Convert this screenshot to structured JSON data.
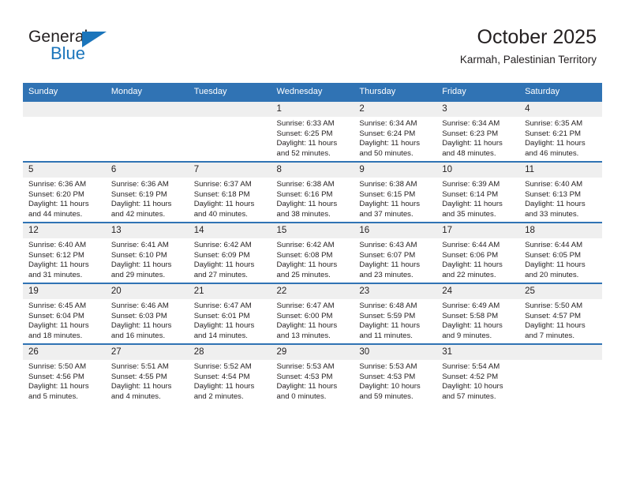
{
  "brand": {
    "name_top": "General",
    "name_bottom": "Blue",
    "accent_color": "#1b75bb",
    "triangle_icon": "triangle-icon"
  },
  "header": {
    "title": "October 2025",
    "subtitle": "Karmah, Palestinian Territory",
    "header_bar_color": "#3073b4"
  },
  "calendar": {
    "weekday_headers": [
      "Sunday",
      "Monday",
      "Tuesday",
      "Wednesday",
      "Thursday",
      "Friday",
      "Saturday"
    ],
    "labels": {
      "sunrise": "Sunrise:",
      "sunset": "Sunset:",
      "daylight": "Daylight:"
    },
    "weeks": [
      [
        {
          "day": ""
        },
        {
          "day": ""
        },
        {
          "day": ""
        },
        {
          "day": "1",
          "sunrise": "Sunrise: 6:33 AM",
          "sunset": "Sunset: 6:25 PM",
          "daylight1": "Daylight: 11 hours",
          "daylight2": "and 52 minutes."
        },
        {
          "day": "2",
          "sunrise": "Sunrise: 6:34 AM",
          "sunset": "Sunset: 6:24 PM",
          "daylight1": "Daylight: 11 hours",
          "daylight2": "and 50 minutes."
        },
        {
          "day": "3",
          "sunrise": "Sunrise: 6:34 AM",
          "sunset": "Sunset: 6:23 PM",
          "daylight1": "Daylight: 11 hours",
          "daylight2": "and 48 minutes."
        },
        {
          "day": "4",
          "sunrise": "Sunrise: 6:35 AM",
          "sunset": "Sunset: 6:21 PM",
          "daylight1": "Daylight: 11 hours",
          "daylight2": "and 46 minutes."
        }
      ],
      [
        {
          "day": "5",
          "sunrise": "Sunrise: 6:36 AM",
          "sunset": "Sunset: 6:20 PM",
          "daylight1": "Daylight: 11 hours",
          "daylight2": "and 44 minutes."
        },
        {
          "day": "6",
          "sunrise": "Sunrise: 6:36 AM",
          "sunset": "Sunset: 6:19 PM",
          "daylight1": "Daylight: 11 hours",
          "daylight2": "and 42 minutes."
        },
        {
          "day": "7",
          "sunrise": "Sunrise: 6:37 AM",
          "sunset": "Sunset: 6:18 PM",
          "daylight1": "Daylight: 11 hours",
          "daylight2": "and 40 minutes."
        },
        {
          "day": "8",
          "sunrise": "Sunrise: 6:38 AM",
          "sunset": "Sunset: 6:16 PM",
          "daylight1": "Daylight: 11 hours",
          "daylight2": "and 38 minutes."
        },
        {
          "day": "9",
          "sunrise": "Sunrise: 6:38 AM",
          "sunset": "Sunset: 6:15 PM",
          "daylight1": "Daylight: 11 hours",
          "daylight2": "and 37 minutes."
        },
        {
          "day": "10",
          "sunrise": "Sunrise: 6:39 AM",
          "sunset": "Sunset: 6:14 PM",
          "daylight1": "Daylight: 11 hours",
          "daylight2": "and 35 minutes."
        },
        {
          "day": "11",
          "sunrise": "Sunrise: 6:40 AM",
          "sunset": "Sunset: 6:13 PM",
          "daylight1": "Daylight: 11 hours",
          "daylight2": "and 33 minutes."
        }
      ],
      [
        {
          "day": "12",
          "sunrise": "Sunrise: 6:40 AM",
          "sunset": "Sunset: 6:12 PM",
          "daylight1": "Daylight: 11 hours",
          "daylight2": "and 31 minutes."
        },
        {
          "day": "13",
          "sunrise": "Sunrise: 6:41 AM",
          "sunset": "Sunset: 6:10 PM",
          "daylight1": "Daylight: 11 hours",
          "daylight2": "and 29 minutes."
        },
        {
          "day": "14",
          "sunrise": "Sunrise: 6:42 AM",
          "sunset": "Sunset: 6:09 PM",
          "daylight1": "Daylight: 11 hours",
          "daylight2": "and 27 minutes."
        },
        {
          "day": "15",
          "sunrise": "Sunrise: 6:42 AM",
          "sunset": "Sunset: 6:08 PM",
          "daylight1": "Daylight: 11 hours",
          "daylight2": "and 25 minutes."
        },
        {
          "day": "16",
          "sunrise": "Sunrise: 6:43 AM",
          "sunset": "Sunset: 6:07 PM",
          "daylight1": "Daylight: 11 hours",
          "daylight2": "and 23 minutes."
        },
        {
          "day": "17",
          "sunrise": "Sunrise: 6:44 AM",
          "sunset": "Sunset: 6:06 PM",
          "daylight1": "Daylight: 11 hours",
          "daylight2": "and 22 minutes."
        },
        {
          "day": "18",
          "sunrise": "Sunrise: 6:44 AM",
          "sunset": "Sunset: 6:05 PM",
          "daylight1": "Daylight: 11 hours",
          "daylight2": "and 20 minutes."
        }
      ],
      [
        {
          "day": "19",
          "sunrise": "Sunrise: 6:45 AM",
          "sunset": "Sunset: 6:04 PM",
          "daylight1": "Daylight: 11 hours",
          "daylight2": "and 18 minutes."
        },
        {
          "day": "20",
          "sunrise": "Sunrise: 6:46 AM",
          "sunset": "Sunset: 6:03 PM",
          "daylight1": "Daylight: 11 hours",
          "daylight2": "and 16 minutes."
        },
        {
          "day": "21",
          "sunrise": "Sunrise: 6:47 AM",
          "sunset": "Sunset: 6:01 PM",
          "daylight1": "Daylight: 11 hours",
          "daylight2": "and 14 minutes."
        },
        {
          "day": "22",
          "sunrise": "Sunrise: 6:47 AM",
          "sunset": "Sunset: 6:00 PM",
          "daylight1": "Daylight: 11 hours",
          "daylight2": "and 13 minutes."
        },
        {
          "day": "23",
          "sunrise": "Sunrise: 6:48 AM",
          "sunset": "Sunset: 5:59 PM",
          "daylight1": "Daylight: 11 hours",
          "daylight2": "and 11 minutes."
        },
        {
          "day": "24",
          "sunrise": "Sunrise: 6:49 AM",
          "sunset": "Sunset: 5:58 PM",
          "daylight1": "Daylight: 11 hours",
          "daylight2": "and 9 minutes."
        },
        {
          "day": "25",
          "sunrise": "Sunrise: 5:50 AM",
          "sunset": "Sunset: 4:57 PM",
          "daylight1": "Daylight: 11 hours",
          "daylight2": "and 7 minutes."
        }
      ],
      [
        {
          "day": "26",
          "sunrise": "Sunrise: 5:50 AM",
          "sunset": "Sunset: 4:56 PM",
          "daylight1": "Daylight: 11 hours",
          "daylight2": "and 5 minutes."
        },
        {
          "day": "27",
          "sunrise": "Sunrise: 5:51 AM",
          "sunset": "Sunset: 4:55 PM",
          "daylight1": "Daylight: 11 hours",
          "daylight2": "and 4 minutes."
        },
        {
          "day": "28",
          "sunrise": "Sunrise: 5:52 AM",
          "sunset": "Sunset: 4:54 PM",
          "daylight1": "Daylight: 11 hours",
          "daylight2": "and 2 minutes."
        },
        {
          "day": "29",
          "sunrise": "Sunrise: 5:53 AM",
          "sunset": "Sunset: 4:53 PM",
          "daylight1": "Daylight: 11 hours",
          "daylight2": "and 0 minutes."
        },
        {
          "day": "30",
          "sunrise": "Sunrise: 5:53 AM",
          "sunset": "Sunset: 4:53 PM",
          "daylight1": "Daylight: 10 hours",
          "daylight2": "and 59 minutes."
        },
        {
          "day": "31",
          "sunrise": "Sunrise: 5:54 AM",
          "sunset": "Sunset: 4:52 PM",
          "daylight1": "Daylight: 10 hours",
          "daylight2": "and 57 minutes."
        },
        {
          "day": ""
        }
      ]
    ]
  }
}
